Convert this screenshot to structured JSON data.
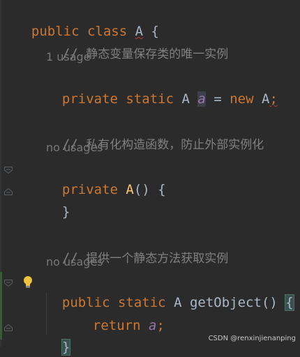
{
  "code": {
    "line1": {
      "kw1": "public",
      "kw2": "class",
      "name": "A",
      "brace": "{"
    },
    "comment1": "静态变量保存类的唯一实例",
    "comment_slash": "//",
    "usage1": "1 usage",
    "line_field": {
      "kw1": "private",
      "kw2": "static",
      "type": "A",
      "field": "a",
      "eq": "=",
      "kw3": "new",
      "ctor": "A",
      "semi": ";"
    },
    "comment2": "私有化构造函数，防止外部实例化",
    "usage2": "no usages",
    "line_ctor": {
      "kw1": "private",
      "name": "A",
      "parens": "()",
      "brace": "{"
    },
    "line_close1": "}",
    "comment3": "提供一个静态方法获取实例",
    "usage3": "no usages",
    "line_method": {
      "kw1": "public",
      "kw2": "static",
      "type": "A",
      "name": "getObject",
      "parens": "()",
      "brace": "{"
    },
    "line_return": {
      "kw": "return",
      "field": "a",
      "semi": ";"
    },
    "line_close2": "}"
  },
  "watermark": "CSDN @renxinjienanping",
  "icons": [
    "fold-icon",
    "lightbulb-icon"
  ]
}
